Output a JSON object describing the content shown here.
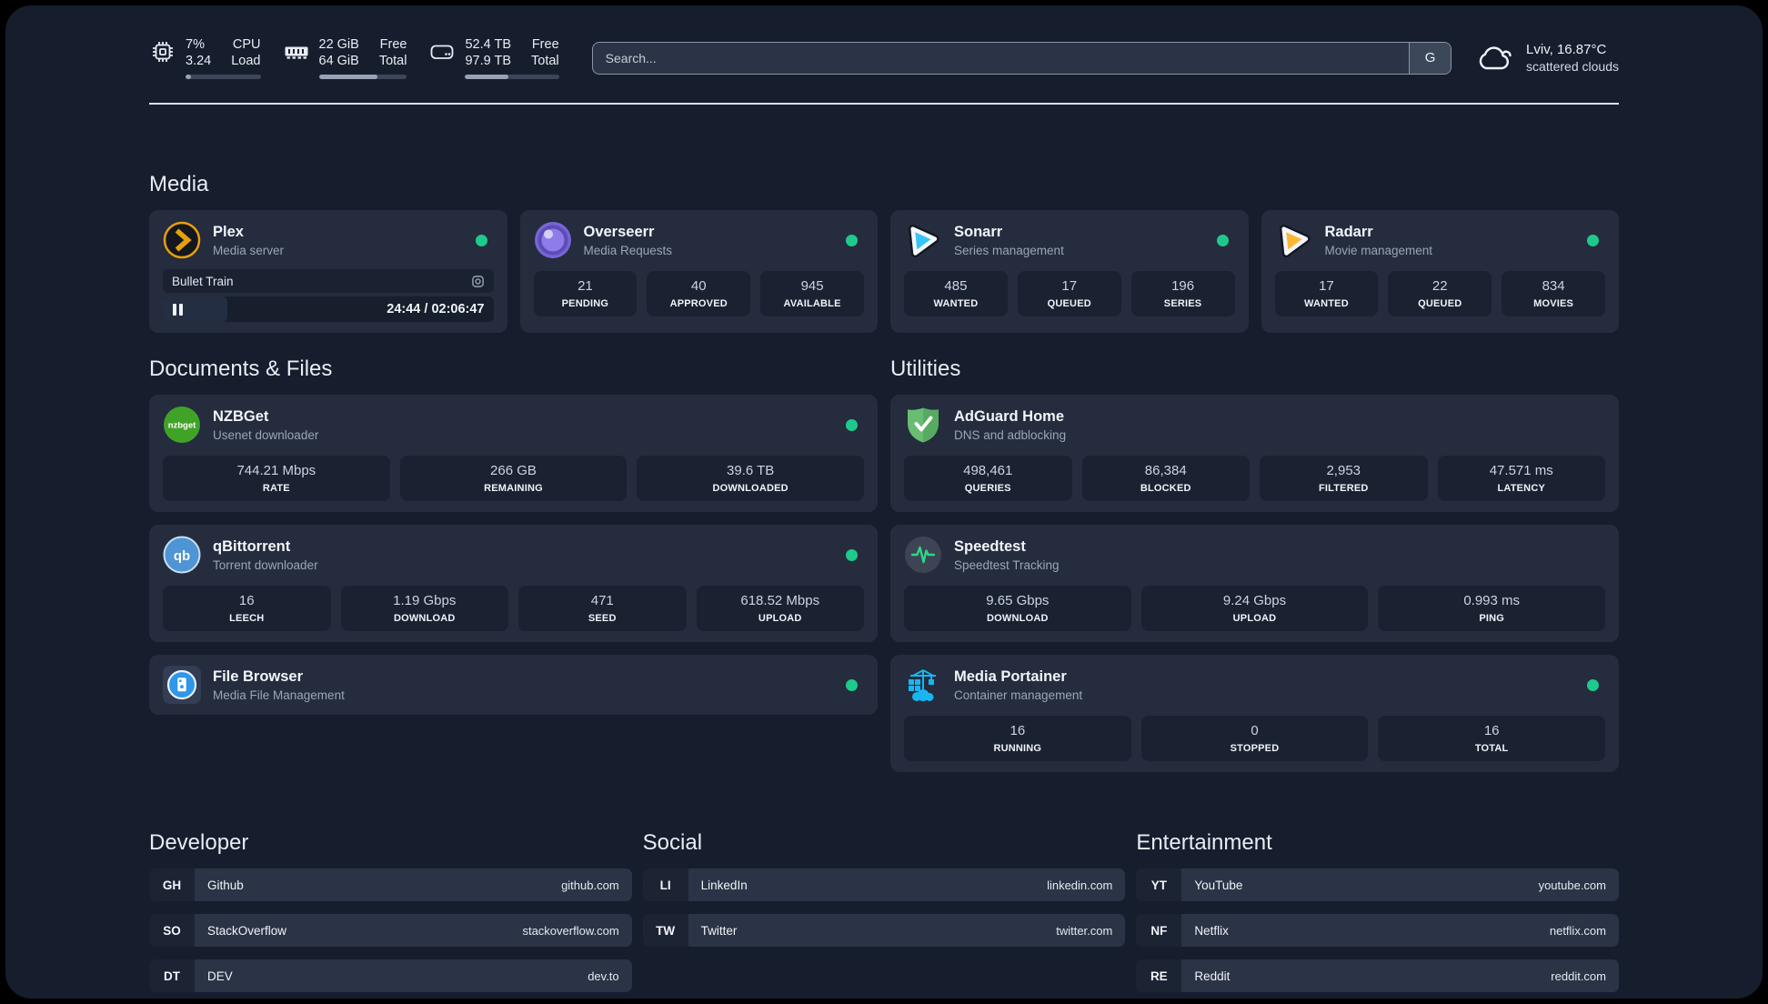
{
  "header": {
    "stats": [
      {
        "icon": "cpu-icon",
        "values": [
          "7%",
          "3.24"
        ],
        "labels": [
          "CPU",
          "Load"
        ],
        "progress": 7
      },
      {
        "icon": "ram-icon",
        "values": [
          "22 GiB",
          "64 GiB"
        ],
        "labels": [
          "Free",
          "Total"
        ],
        "progress": 66
      },
      {
        "icon": "disk-icon",
        "values": [
          "52.4 TB",
          "97.9 TB"
        ],
        "labels": [
          "Free",
          "Total"
        ],
        "progress": 46
      }
    ],
    "search": {
      "placeholder": "Search...",
      "engine_label": "G"
    },
    "weather": {
      "location": "Lviv, 16.87°C",
      "condition": "scattered clouds"
    }
  },
  "media": {
    "heading": "Media",
    "cards": [
      {
        "title": "Plex",
        "subtitle": "Media server",
        "online": true,
        "player": {
          "title": "Bullet Train",
          "time": "24:44 / 02:06:47",
          "progress": 19.5
        }
      },
      {
        "title": "Overseerr",
        "subtitle": "Media Requests",
        "online": true,
        "stats": [
          {
            "value": "21",
            "label": "PENDING"
          },
          {
            "value": "40",
            "label": "APPROVED"
          },
          {
            "value": "945",
            "label": "AVAILABLE"
          }
        ]
      },
      {
        "title": "Sonarr",
        "subtitle": "Series management",
        "online": true,
        "stats": [
          {
            "value": "485",
            "label": "WANTED"
          },
          {
            "value": "17",
            "label": "QUEUED"
          },
          {
            "value": "196",
            "label": "SERIES"
          }
        ]
      },
      {
        "title": "Radarr",
        "subtitle": "Movie management",
        "online": true,
        "stats": [
          {
            "value": "17",
            "label": "WANTED"
          },
          {
            "value": "22",
            "label": "QUEUED"
          },
          {
            "value": "834",
            "label": "MOVIES"
          }
        ]
      }
    ]
  },
  "documents": {
    "heading": "Documents & Files",
    "cards": [
      {
        "title": "NZBGet",
        "subtitle": "Usenet downloader",
        "online": true,
        "stats": [
          {
            "value": "744.21 Mbps",
            "label": "RATE"
          },
          {
            "value": "266 GB",
            "label": "REMAINING"
          },
          {
            "value": "39.6 TB",
            "label": "DOWNLOADED"
          }
        ]
      },
      {
        "title": "qBittorrent",
        "subtitle": "Torrent downloader",
        "online": true,
        "stats": [
          {
            "value": "16",
            "label": "LEECH"
          },
          {
            "value": "1.19 Gbps",
            "label": "DOWNLOAD"
          },
          {
            "value": "471",
            "label": "SEED"
          },
          {
            "value": "618.52 Mbps",
            "label": "UPLOAD"
          }
        ]
      },
      {
        "title": "File Browser",
        "subtitle": "Media File Management",
        "online": true
      }
    ]
  },
  "utilities": {
    "heading": "Utilities",
    "cards": [
      {
        "title": "AdGuard Home",
        "subtitle": "DNS and adblocking",
        "stats": [
          {
            "value": "498,461",
            "label": "QUERIES"
          },
          {
            "value": "86,384",
            "label": "BLOCKED"
          },
          {
            "value": "2,953",
            "label": "FILTERED"
          },
          {
            "value": "47.571 ms",
            "label": "LATENCY"
          }
        ]
      },
      {
        "title": "Speedtest",
        "subtitle": "Speedtest Tracking",
        "stats": [
          {
            "value": "9.65 Gbps",
            "label": "DOWNLOAD"
          },
          {
            "value": "9.24 Gbps",
            "label": "UPLOAD"
          },
          {
            "value": "0.993 ms",
            "label": "PING"
          }
        ]
      },
      {
        "title": "Media Portainer",
        "subtitle": "Container management",
        "online": true,
        "stats": [
          {
            "value": "16",
            "label": "RUNNING"
          },
          {
            "value": "0",
            "label": "STOPPED"
          },
          {
            "value": "16",
            "label": "TOTAL"
          }
        ]
      }
    ]
  },
  "links": {
    "columns": [
      {
        "heading": "Developer",
        "items": [
          {
            "abbr": "GH",
            "name": "Github",
            "url": "github.com"
          },
          {
            "abbr": "SO",
            "name": "StackOverflow",
            "url": "stackoverflow.com"
          },
          {
            "abbr": "DT",
            "name": "DEV",
            "url": "dev.to"
          }
        ]
      },
      {
        "heading": "Social",
        "items": [
          {
            "abbr": "LI",
            "name": "LinkedIn",
            "url": "linkedin.com"
          },
          {
            "abbr": "TW",
            "name": "Twitter",
            "url": "twitter.com"
          }
        ]
      },
      {
        "heading": "Entertainment",
        "items": [
          {
            "abbr": "YT",
            "name": "YouTube",
            "url": "youtube.com"
          },
          {
            "abbr": "NF",
            "name": "Netflix",
            "url": "netflix.com"
          },
          {
            "abbr": "RE",
            "name": "Reddit",
            "url": "reddit.com"
          }
        ]
      }
    ]
  },
  "colors": {
    "online_dot": "#1ec98c",
    "plex_gold": "#e5a00d",
    "sonarr_cyan": "#35c5f4",
    "radarr_yellow": "#fdb833",
    "adguard_green": "#68bd73",
    "portainer_blue": "#18b6f0",
    "qbittorrent_blue": "#4f94d4",
    "nzbget_green": "#40a327"
  }
}
